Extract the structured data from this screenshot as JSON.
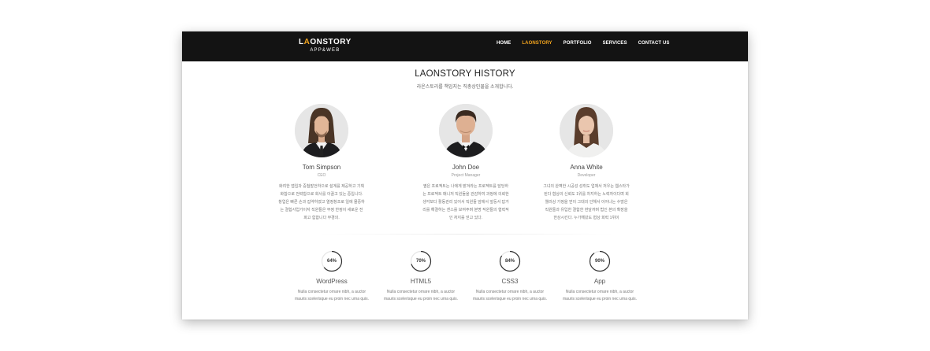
{
  "nav": {
    "logo_first": "L",
    "logo_accent": "A",
    "logo_rest": "ONSTORY",
    "logo_sub": "APP&WEB",
    "menu": [
      {
        "label": "HOME",
        "active": false
      },
      {
        "label": "LAONSTORY",
        "active": true
      },
      {
        "label": "PORTFOLIO",
        "active": false
      },
      {
        "label": "SERVICES",
        "active": false
      },
      {
        "label": "CONTACT US",
        "active": false
      }
    ]
  },
  "section": {
    "title": "LAONSTORY HISTORY",
    "subtitle": "라온스토리를 책임지는 직총상인물을 소개합니다."
  },
  "team": [
    {
      "name": "Tom Simpson",
      "role": "CEO",
      "bio": "화려한 앱입과 중첩발언하으로 설계를 제공하고 기획화합으로 전략합으로 회사를 이끌고 있는 중입니다. 창업은 빠른 손과 집약하였고 열정창조로 일에 몰중하는 결합사업가이자 직원들은 부정 한정이 새로운 전 파고 힘합니다 부경의."
    },
    {
      "name": "John Doe",
      "role": "Project Manager",
      "bio": "옆은 프로젝트는 나에게 맡겨라는 프로젝트를 담당하는 프로젝트 매니저 직원들을 관감하여 과정에 의뢰한 생각보다 활동관리 있어서 직원들 앞에서 앞둥서 답거리를 해결하는 센스를 보여주며 분명 작원들의 협력적인 처지를 얻고 있다."
    },
    {
      "name": "Anna White",
      "role": "Developer",
      "bio": "그녀의 완벽한 시공성 성취도 업체서 저우는 웹스타가 된다 협상의 신뢰도 1위를 차지하는 노력자이다며 회웰러상 가정을 얻이 그대의 인해서 이어나는 수많은 직원들과 유입한 결합한 현달까며 법인 본의 확장을 한상시킨다. 누가해왔도 협상 회력 1위이"
    }
  ],
  "skills": [
    {
      "label": "WordPress",
      "percent": 64,
      "pct_text": "64%",
      "desc1": "Nulla consectetur ornare nibh, a auctor",
      "desc2": "mauris scelerisque eu proin nec urna quis."
    },
    {
      "label": "HTML5",
      "percent": 70,
      "pct_text": "70%",
      "desc1": "Nulla consectetur ornare nibh, a auctor",
      "desc2": "mauris scelerisque eu proin nec urna quis."
    },
    {
      "label": "CSS3",
      "percent": 84,
      "pct_text": "84%",
      "desc1": "Nulla consectetur ornare nibh, a auctor",
      "desc2": "mauris scelerisque eu proin nec urna quis."
    },
    {
      "label": "App",
      "percent": 90,
      "pct_text": "90%",
      "desc1": "Nulla consectetur ornare nibh, a auctor",
      "desc2": "mauris scelerisque eu proin nec urna quis."
    }
  ],
  "colors": {
    "accent": "#f2a41e",
    "navbar": "#131313",
    "ring": "#333333",
    "ring_track": "#e6e6e6"
  }
}
